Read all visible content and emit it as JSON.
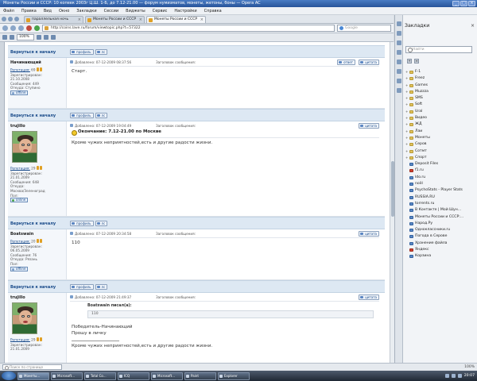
{
  "window": {
    "title": "Монеты России и СССР: 10 копеек 2003г Ц.Ш. 1-Б, до 7.12-21.00 — форум нумизматов, монеты, жетоны, боны — Opera AC"
  },
  "menu": [
    "Файл",
    "Правка",
    "Вид",
    "Окно",
    "Закладки",
    "Сессии",
    "Виджеты",
    "Сервис",
    "Настройки",
    "Справка"
  ],
  "tabs": [
    {
      "label": "параллельная ночь",
      "active": false
    },
    {
      "label": "Монеты России и СССР",
      "active": false
    },
    {
      "label": "Монеты России и СССР",
      "active": true
    }
  ],
  "address": {
    "url": "http://coins.lave.ru/forum/viewtopic.php?t=57322",
    "search_placeholder": "Google"
  },
  "toolbar": {
    "zoom": "100%"
  },
  "forum": {
    "back_label": "Вернуться к началу",
    "profile_label": "профиль",
    "pm_label": "лс",
    "reply_label": "ответ",
    "quote_label": "цитата",
    "posts": [
      {
        "author": "Начинающий",
        "reputation_label": "Репутация:",
        "reputation": "69",
        "registered_label": "Зарегистрирован:",
        "registered": "21.10.2008",
        "messages_label": "Сообщения:",
        "messages": "449",
        "from_label": "Откуда:",
        "from": "Ступино",
        "status": "offline",
        "date": "Добавлено: 07-12-2009 08:37:56",
        "subject_label": "Заголовок сообщения:",
        "text": "Старт."
      },
      {
        "author": "trujillo",
        "reputation_label": "Репутация:",
        "reputation": "29",
        "registered_label": "Зарегистрирован:",
        "registered": "21.01.2009",
        "messages_label": "Сообщения:",
        "messages": "648",
        "from_label": "Откуда:",
        "from": "Москва/Зеленоград",
        "sex_label": "Пол:",
        "status": "online",
        "date": "Добавлено: 07-12-2009 19:04:49",
        "subject_label": "Заголовок сообщения:",
        "title": "Окончание: 7.12-21.00 по Москве",
        "text": "Кроме чужих неприятностей,есть и другие радости жизни."
      },
      {
        "author": "Boatswain",
        "reputation_label": "Репутация:",
        "reputation": "20",
        "registered_label": "Зарегистрирован:",
        "registered": "06.05.2009",
        "messages_label": "Сообщения:",
        "messages": "76",
        "from_label": "Откуда:",
        "from": "Рязань",
        "sex_label": "Пол:",
        "status": "offline",
        "date": "Добавлено: 07-12-2009 20:34:58",
        "subject_label": "Заголовок сообщения:",
        "text": "110"
      },
      {
        "author": "trujillo",
        "reputation_label": "Репутация:",
        "reputation": "29",
        "registered_label": "Зарегистрирован:",
        "registered": "21.01.2009",
        "date": "Добавлено: 07-12-2009 21:49:37",
        "subject_label": "Заголовок сообщения:",
        "quote_head": "Boatswain писал(а):",
        "quote_body": "110",
        "text1": "Победитель-Начинающий",
        "text2": "Прошу в личку",
        "sig": "Кроме чужих неприятностей,есть и другие радости жизни."
      }
    ]
  },
  "panel": {
    "title": "Закладки",
    "search_placeholder": "Найти",
    "bookmarks": [
      {
        "label": "F-1",
        "type": "folder"
      },
      {
        "label": "Freez",
        "type": "folder"
      },
      {
        "label": "Games",
        "type": "folder"
      },
      {
        "label": "Muzzza",
        "type": "folder"
      },
      {
        "label": "SMS",
        "type": "folder"
      },
      {
        "label": "Soft",
        "type": "folder"
      },
      {
        "label": "Ural",
        "type": "folder"
      },
      {
        "label": "Видео",
        "type": "folder"
      },
      {
        "label": "ЖД",
        "type": "folder"
      },
      {
        "label": "Лаи",
        "type": "folder"
      },
      {
        "label": "Монеты",
        "type": "folder"
      },
      {
        "label": "Серов",
        "type": "folder"
      },
      {
        "label": "Сотмт",
        "type": "folder"
      },
      {
        "label": "Спорт",
        "type": "folder"
      },
      {
        "label": "Deposit Files",
        "type": "site"
      },
      {
        "label": "f1.ru",
        "type": "red"
      },
      {
        "label": "ldo.ru",
        "type": "site"
      },
      {
        "label": "noël",
        "type": "site"
      },
      {
        "label": "PsychoStats - Player Stats",
        "type": "site"
      },
      {
        "label": "RUSSIA.RU",
        "type": "site"
      },
      {
        "label": "torrents.ru",
        "type": "site"
      },
      {
        "label": "В Контакте | Мой Шун...",
        "type": "site"
      },
      {
        "label": "Монеты России и СССР:...",
        "type": "site"
      },
      {
        "label": "Народ.Ру",
        "type": "site"
      },
      {
        "label": "Одноклассники.ru",
        "type": "site"
      },
      {
        "label": "Погода в Серове",
        "type": "site"
      },
      {
        "label": "Хранение файла",
        "type": "site"
      },
      {
        "label": "Яндекс",
        "type": "red"
      },
      {
        "label": "Корзина",
        "type": "site"
      }
    ]
  },
  "status": {
    "find_placeholder": "Поиск по странице"
  },
  "taskbar": {
    "items": [
      {
        "label": "Монеты...",
        "active": true
      },
      {
        "label": "Microsoft...",
        "active": false
      },
      {
        "label": "Total Co...",
        "active": false
      },
      {
        "label": "ICQ",
        "active": false
      },
      {
        "label": "Microsoft...",
        "active": false
      },
      {
        "label": "Paint",
        "active": false
      },
      {
        "label": "Explorer",
        "active": false
      }
    ],
    "clock": "20:07"
  }
}
